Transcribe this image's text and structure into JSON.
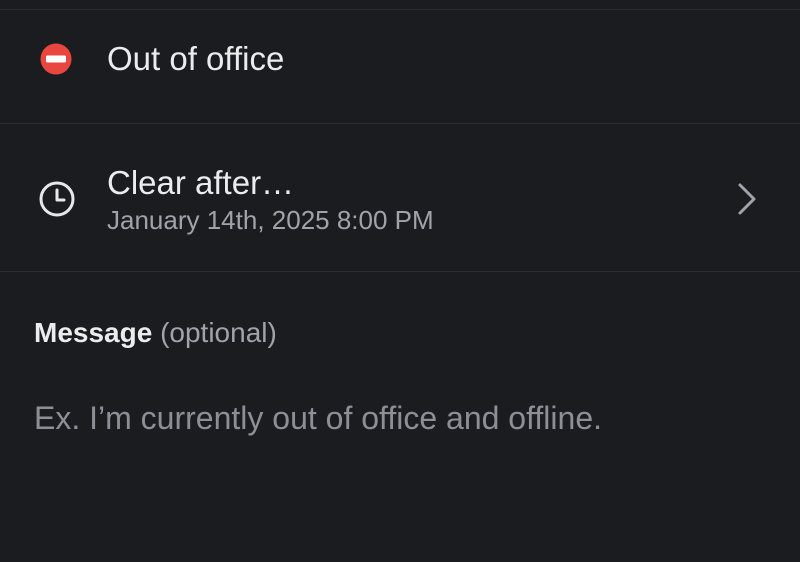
{
  "status": {
    "emoji_icon": "no-entry-icon",
    "text": "Out of office"
  },
  "clear_after": {
    "icon": "clock-icon",
    "title": "Clear after…",
    "subtitle": "January 14th, 2025 8:00 PM",
    "chevron_icon": "chevron-right-icon"
  },
  "message": {
    "label": "Message",
    "optional_label": "(optional)",
    "value": "",
    "placeholder": "Ex. I’m currently out of office and offline."
  },
  "colors": {
    "background": "#1b1c20",
    "divider": "#2c2d33",
    "emoji_red": "#e8463f",
    "text_primary": "#ececee",
    "text_secondary": "#a2a3a8"
  }
}
